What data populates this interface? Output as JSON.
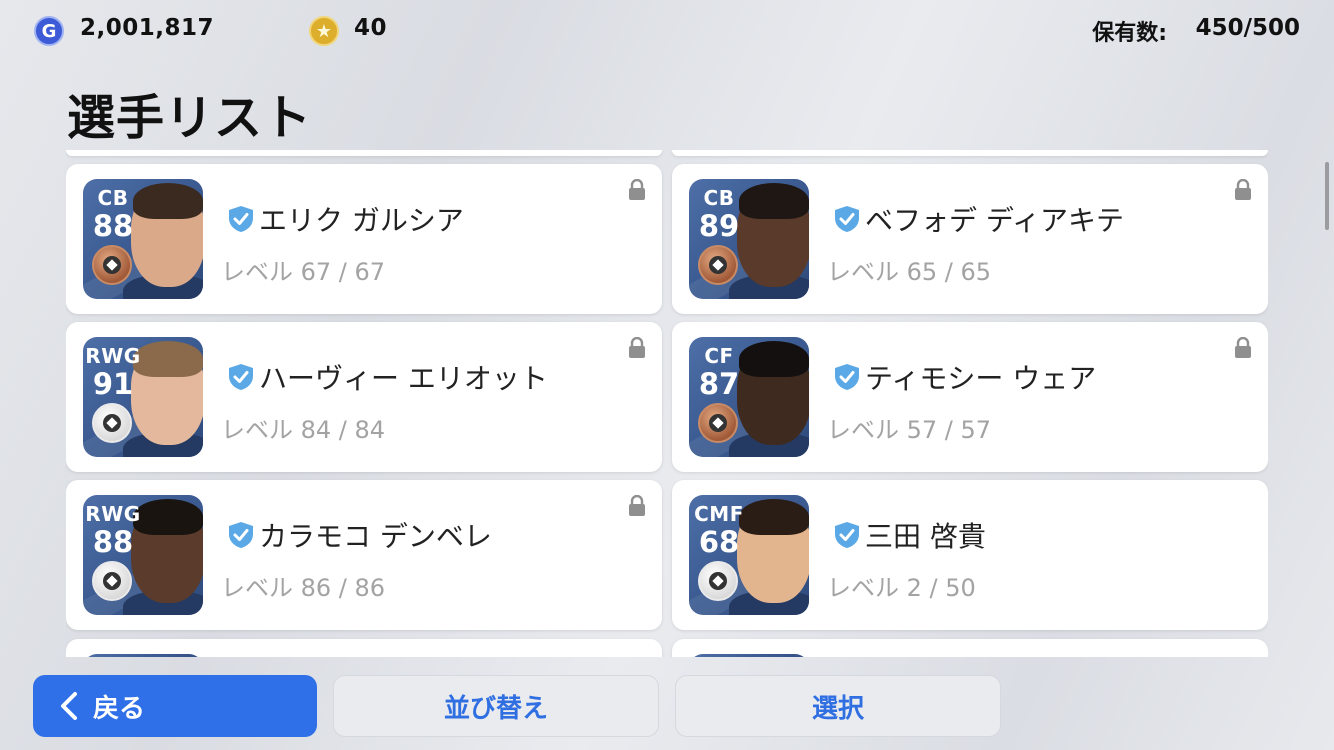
{
  "currency": {
    "gp": {
      "icon": "g-coin-icon",
      "letter": "G",
      "value": "2,001,817"
    },
    "coins": {
      "icon": "star-coin-icon",
      "value": "40"
    }
  },
  "owned": {
    "label": "保有数:",
    "value": "450/500"
  },
  "page": {
    "title": "選手リスト"
  },
  "players": [
    {
      "position": "CB",
      "rating": "88",
      "name": "エリク ガルシア",
      "level": "レベル 67 / 67",
      "medal": "bronze",
      "locked": true,
      "skin": "#d9a98a",
      "hair": "#3b2a20"
    },
    {
      "position": "CB",
      "rating": "89",
      "name": "ベフォデ ディアキテ",
      "level": "レベル 65 / 65",
      "medal": "bronze",
      "locked": true,
      "skin": "#5a3a2a",
      "hair": "#1e1714"
    },
    {
      "position": "RWG",
      "rating": "91",
      "name": "ハーヴィー エリオット",
      "level": "レベル 84 / 84",
      "medal": "white",
      "locked": true,
      "skin": "#e3b89c",
      "hair": "#8a6a4a"
    },
    {
      "position": "CF",
      "rating": "87",
      "name": "ティモシー ウェア",
      "level": "レベル 57 / 57",
      "medal": "bronze",
      "locked": true,
      "skin": "#3f2a20",
      "hair": "#141010"
    },
    {
      "position": "RWG",
      "rating": "88",
      "name": "カラモコ デンベレ",
      "level": "レベル 86 / 86",
      "medal": "white",
      "locked": true,
      "skin": "#5b3b2b",
      "hair": "#1a1411"
    },
    {
      "position": "CMF",
      "rating": "68",
      "name": "三田 啓貴",
      "level": "レベル 2 / 50",
      "medal": "white",
      "locked": false,
      "skin": "#e2b58f",
      "hair": "#2a1d16"
    }
  ],
  "buttons": {
    "back": "戻る",
    "sort": "並び替え",
    "select": "選択"
  },
  "colors": {
    "accent": "#2f70e8",
    "check": "#5aa9e6",
    "bronze": "#a15a38"
  }
}
